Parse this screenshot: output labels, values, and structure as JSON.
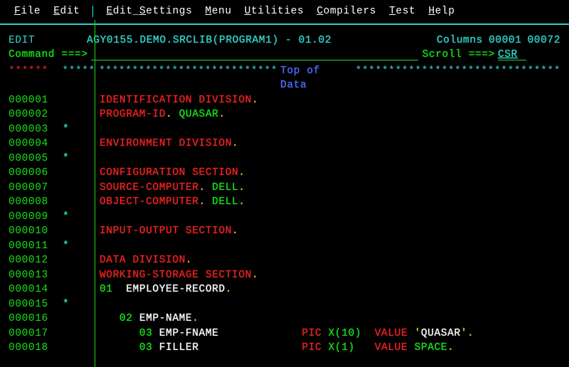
{
  "menu": {
    "file": "File",
    "edit": "Edit",
    "edit_settings": "Edit_Settings",
    "menu": "Menu",
    "utilities": "Utilities",
    "compilers": "Compilers",
    "test": "Test",
    "help": "Help"
  },
  "status": {
    "mode": "EDIT",
    "dataset": "AGY0155.DEMO.SRCLIB(PROGRAM1) - 01.02",
    "columns_label": "Columns",
    "col_from": "00001",
    "col_to": "00072"
  },
  "command": {
    "label": "Command ===>",
    "value": "",
    "scroll_label": "Scroll ===>",
    "scroll_value": "CSR"
  },
  "tod": {
    "stars_left": "******",
    "stars_gap_l": "***************************",
    "label": "Top of Data",
    "stars_gap_r": "*******************************"
  },
  "lines": [
    {
      "n": "000001",
      "seg": [
        {
          "t": "IDENTIFICATION DIVISION",
          "c": "red"
        },
        {
          "t": ".",
          "c": "yellow"
        }
      ]
    },
    {
      "n": "000002",
      "seg": [
        {
          "t": "PROGRAM-ID",
          "c": "red"
        },
        {
          "t": ". ",
          "c": "yellow"
        },
        {
          "t": "QUASAR",
          "c": "green"
        },
        {
          "t": ".",
          "c": "yellow"
        }
      ]
    },
    {
      "n": "000003",
      "seg": [],
      "star": true
    },
    {
      "n": "000004",
      "seg": [
        {
          "t": "ENVIRONMENT DIVISION",
          "c": "red"
        },
        {
          "t": ".",
          "c": "yellow"
        }
      ]
    },
    {
      "n": "000005",
      "seg": [],
      "star": true
    },
    {
      "n": "000006",
      "seg": [
        {
          "t": "CONFIGURATION SECTION",
          "c": "red"
        },
        {
          "t": ".",
          "c": "yellow"
        }
      ]
    },
    {
      "n": "000007",
      "seg": [
        {
          "t": "SOURCE-COMPUTER",
          "c": "red"
        },
        {
          "t": ". ",
          "c": "yellow"
        },
        {
          "t": "DELL",
          "c": "green"
        },
        {
          "t": ".",
          "c": "yellow"
        }
      ]
    },
    {
      "n": "000008",
      "seg": [
        {
          "t": "OBJECT-COMPUTER",
          "c": "red"
        },
        {
          "t": ". ",
          "c": "yellow"
        },
        {
          "t": "DELL",
          "c": "green"
        },
        {
          "t": ".",
          "c": "yellow"
        }
      ]
    },
    {
      "n": "000009",
      "seg": [],
      "star": true
    },
    {
      "n": "000010",
      "seg": [
        {
          "t": "INPUT-OUTPUT SECTION",
          "c": "red"
        },
        {
          "t": ".",
          "c": "yellow"
        }
      ]
    },
    {
      "n": "000011",
      "seg": [],
      "star": true
    },
    {
      "n": "000012",
      "seg": [
        {
          "t": "DATA DIVISION",
          "c": "red"
        },
        {
          "t": ".",
          "c": "yellow"
        }
      ]
    },
    {
      "n": "000013",
      "seg": [
        {
          "t": "WORKING-STORAGE SECTION",
          "c": "red"
        },
        {
          "t": ".",
          "c": "yellow"
        }
      ]
    },
    {
      "n": "000014",
      "seg": [
        {
          "t": "01",
          "c": "green"
        },
        {
          "t": "  EMPLOYEE-RECORD",
          "c": "white"
        },
        {
          "t": ".",
          "c": "yellow"
        }
      ]
    },
    {
      "n": "000015",
      "seg": [],
      "star": true
    },
    {
      "n": "000016",
      "seg": [
        {
          "t": "   02",
          "c": "green"
        },
        {
          "t": " EMP-NAME",
          "c": "white"
        },
        {
          "t": ".",
          "c": "yellow"
        }
      ]
    },
    {
      "n": "000017",
      "seg": [
        {
          "t": "      03",
          "c": "green"
        },
        {
          "t": " EMP-FNAME",
          "c": "white",
          "w": true
        },
        {
          "t": "PIC",
          "c": "red"
        },
        {
          "t": " X(",
          "c": "green"
        },
        {
          "t": "10",
          "c": "green"
        },
        {
          "t": ")  ",
          "c": "green"
        },
        {
          "t": "VALUE",
          "c": "red"
        },
        {
          "t": " '",
          "c": "yellow"
        },
        {
          "t": "QUASAR",
          "c": "white"
        },
        {
          "t": "'.",
          "c": "yellow"
        }
      ]
    },
    {
      "n": "000018",
      "seg": [
        {
          "t": "      03",
          "c": "green"
        },
        {
          "t": " FILLER",
          "c": "white",
          "w": true
        },
        {
          "t": "PIC",
          "c": "red"
        },
        {
          "t": " X(",
          "c": "green"
        },
        {
          "t": "1",
          "c": "green"
        },
        {
          "t": ")   ",
          "c": "green"
        },
        {
          "t": "VALUE",
          "c": "red"
        },
        {
          "t": " ",
          "c": "green"
        },
        {
          "t": "SPACE",
          "c": "green"
        },
        {
          "t": ".",
          "c": "yellow"
        }
      ]
    }
  ]
}
